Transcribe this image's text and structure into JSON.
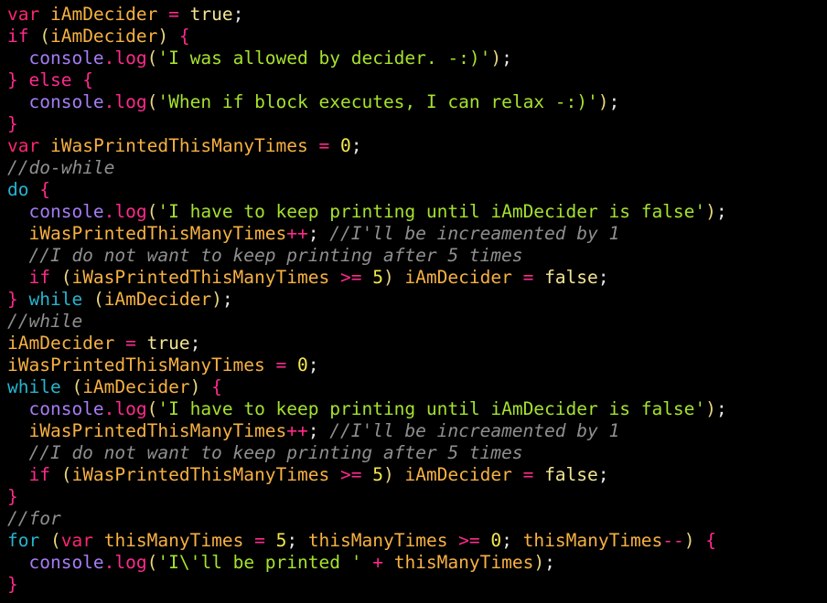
{
  "editor": {
    "colors": {
      "background": "#000000",
      "ws": "#cfcfcf",
      "keyword": "#f92672",
      "flow": "#fe2a8c",
      "var": "#f7b142",
      "console": "#a67cf5",
      "method": "#fe2a8c",
      "string": "#a6e22e",
      "number": "#f5e84c",
      "bool": "#f2e592",
      "comment": "#8f8f8f",
      "teal": "#25b5cf",
      "paren": "#e8d57e",
      "bracket": "#e6e6e6"
    },
    "lines": [
      [
        [
          "var",
          "kw"
        ],
        [
          " ",
          "ws"
        ],
        [
          "iAmDecider",
          "var"
        ],
        [
          " = ",
          "op"
        ],
        [
          "true",
          "bool"
        ],
        [
          ";",
          "punct"
        ]
      ],
      [
        [
          "if",
          "flow"
        ],
        [
          " (",
          "paren"
        ],
        [
          "iAmDecider",
          "var"
        ],
        [
          ") ",
          "paren"
        ],
        [
          "{",
          "flow"
        ]
      ],
      [
        [
          "  ",
          "ws"
        ],
        [
          "console",
          "console"
        ],
        [
          ".",
          "flow"
        ],
        [
          "log",
          "flow"
        ],
        [
          "(",
          "paren"
        ],
        [
          "'I was allowed by decider. -:)'",
          "string"
        ],
        [
          ")",
          "paren"
        ],
        [
          ";",
          "punct"
        ]
      ],
      [
        [
          "}",
          "flow"
        ],
        [
          " ",
          "ws"
        ],
        [
          "else",
          "flow"
        ],
        [
          " ",
          "ws"
        ],
        [
          "{",
          "flow"
        ]
      ],
      [
        [
          "  ",
          "ws"
        ],
        [
          "console",
          "console"
        ],
        [
          ".",
          "flow"
        ],
        [
          "log",
          "flow"
        ],
        [
          "(",
          "paren"
        ],
        [
          "'When if block executes, I can relax -:)'",
          "string"
        ],
        [
          ")",
          "paren"
        ],
        [
          ";",
          "punct"
        ]
      ],
      [
        [
          "}",
          "flow"
        ]
      ],
      [
        [
          "var",
          "kw"
        ],
        [
          " ",
          "ws"
        ],
        [
          "iWasPrintedThisManyTimes",
          "var"
        ],
        [
          " = ",
          "op"
        ],
        [
          "0",
          "number"
        ],
        [
          ";",
          "punct"
        ]
      ],
      [
        [
          "//do-while",
          "comment"
        ]
      ],
      [
        [
          "do",
          "teal"
        ],
        [
          " ",
          "ws"
        ],
        [
          "{",
          "flow"
        ]
      ],
      [
        [
          "  ",
          "ws"
        ],
        [
          "console",
          "console"
        ],
        [
          ".",
          "flow"
        ],
        [
          "log",
          "flow"
        ],
        [
          "(",
          "paren"
        ],
        [
          "'I have to keep printing until iAmDecider is false'",
          "string"
        ],
        [
          ")",
          "paren"
        ],
        [
          ";",
          "punct"
        ]
      ],
      [
        [
          "  ",
          "ws"
        ],
        [
          "iWasPrintedThisManyTimes",
          "var"
        ],
        [
          "++",
          "flow"
        ],
        [
          ";",
          "punct"
        ],
        [
          " //I'll be increamented by 1",
          "comment"
        ]
      ],
      [
        [
          "  //I do not want to keep printing after 5 times",
          "comment"
        ]
      ],
      [
        [
          "  ",
          "ws"
        ],
        [
          "if",
          "flow"
        ],
        [
          " (",
          "paren"
        ],
        [
          "iWasPrintedThisManyTimes",
          "var"
        ],
        [
          " >= ",
          "flow"
        ],
        [
          "5",
          "number"
        ],
        [
          ") ",
          "paren"
        ],
        [
          "iAmDecider",
          "var"
        ],
        [
          " = ",
          "op"
        ],
        [
          "false",
          "bool"
        ],
        [
          ";",
          "punct"
        ]
      ],
      [
        [
          "}",
          "flow"
        ],
        [
          " ",
          "ws"
        ],
        [
          "while",
          "teal"
        ],
        [
          " (",
          "paren"
        ],
        [
          "iAmDecider",
          "var"
        ],
        [
          ")",
          "paren"
        ],
        [
          ";",
          "punct"
        ]
      ],
      [
        [
          "//while",
          "comment"
        ]
      ],
      [
        [
          "iAmDecider",
          "var"
        ],
        [
          " = ",
          "op"
        ],
        [
          "true",
          "bool"
        ],
        [
          ";",
          "punct"
        ]
      ],
      [
        [
          "iWasPrintedThisManyTimes",
          "var"
        ],
        [
          " = ",
          "op"
        ],
        [
          "0",
          "number"
        ],
        [
          ";",
          "punct"
        ]
      ],
      [
        [
          "while",
          "teal"
        ],
        [
          " (",
          "paren"
        ],
        [
          "iAmDecider",
          "var"
        ],
        [
          ") ",
          "paren"
        ],
        [
          "{",
          "flow"
        ]
      ],
      [
        [
          "  ",
          "ws"
        ],
        [
          "console",
          "console"
        ],
        [
          ".",
          "flow"
        ],
        [
          "log",
          "flow"
        ],
        [
          "(",
          "paren"
        ],
        [
          "'I have to keep printing until iAmDecider is false'",
          "string"
        ],
        [
          ")",
          "paren"
        ],
        [
          ";",
          "punct"
        ]
      ],
      [
        [
          "  ",
          "ws"
        ],
        [
          "iWasPrintedThisManyTimes",
          "var"
        ],
        [
          "++",
          "flow"
        ],
        [
          ";",
          "punct"
        ],
        [
          " //I'll be increamented by 1",
          "comment"
        ]
      ],
      [
        [
          "  //I do not want to keep printing after 5 times",
          "comment"
        ]
      ],
      [
        [
          "  ",
          "ws"
        ],
        [
          "if",
          "flow"
        ],
        [
          " (",
          "paren"
        ],
        [
          "iWasPrintedThisManyTimes",
          "var"
        ],
        [
          " >= ",
          "flow"
        ],
        [
          "5",
          "number"
        ],
        [
          ") ",
          "paren"
        ],
        [
          "iAmDecider",
          "var"
        ],
        [
          " = ",
          "op"
        ],
        [
          "false",
          "bool"
        ],
        [
          ";",
          "punct"
        ]
      ],
      [
        [
          "}",
          "flow"
        ]
      ],
      [
        [
          "//for",
          "comment"
        ]
      ],
      [
        [
          "for",
          "teal"
        ],
        [
          " (",
          "paren"
        ],
        [
          "var",
          "kw"
        ],
        [
          " ",
          "ws"
        ],
        [
          "thisManyTimes",
          "var"
        ],
        [
          " = ",
          "op"
        ],
        [
          "5",
          "number"
        ],
        [
          ";",
          "punct"
        ],
        [
          " ",
          "ws"
        ],
        [
          "thisManyTimes",
          "var"
        ],
        [
          " >= ",
          "flow"
        ],
        [
          "0",
          "number"
        ],
        [
          ";",
          "punct"
        ],
        [
          " ",
          "ws"
        ],
        [
          "thisManyTimes",
          "var"
        ],
        [
          "--",
          "flow"
        ],
        [
          ") ",
          "paren"
        ],
        [
          "{",
          "flow"
        ]
      ],
      [
        [
          "  ",
          "ws"
        ],
        [
          "console",
          "console"
        ],
        [
          ".",
          "flow"
        ],
        [
          "log",
          "flow"
        ],
        [
          "(",
          "paren"
        ],
        [
          "'I\\'ll be printed '",
          "string"
        ],
        [
          " + ",
          "op"
        ],
        [
          "thisManyTimes",
          "var"
        ],
        [
          ")",
          "paren"
        ],
        [
          ";",
          "punct"
        ]
      ],
      [
        [
          "}",
          "flow"
        ]
      ]
    ]
  }
}
